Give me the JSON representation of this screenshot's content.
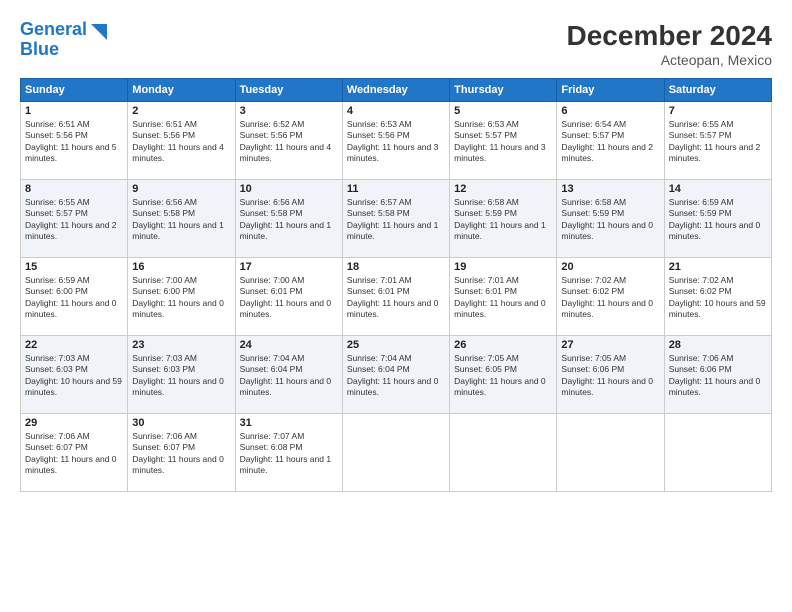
{
  "header": {
    "logo_line1": "General",
    "logo_line2": "Blue",
    "month": "December 2024",
    "location": "Acteopan, Mexico"
  },
  "days_of_week": [
    "Sunday",
    "Monday",
    "Tuesday",
    "Wednesday",
    "Thursday",
    "Friday",
    "Saturday"
  ],
  "weeks": [
    [
      {
        "day": "1",
        "rise": "6:51 AM",
        "set": "5:56 PM",
        "daylight": "11 hours and 5 minutes."
      },
      {
        "day": "2",
        "rise": "6:51 AM",
        "set": "5:56 PM",
        "daylight": "11 hours and 4 minutes."
      },
      {
        "day": "3",
        "rise": "6:52 AM",
        "set": "5:56 PM",
        "daylight": "11 hours and 4 minutes."
      },
      {
        "day": "4",
        "rise": "6:53 AM",
        "set": "5:56 PM",
        "daylight": "11 hours and 3 minutes."
      },
      {
        "day": "5",
        "rise": "6:53 AM",
        "set": "5:57 PM",
        "daylight": "11 hours and 3 minutes."
      },
      {
        "day": "6",
        "rise": "6:54 AM",
        "set": "5:57 PM",
        "daylight": "11 hours and 2 minutes."
      },
      {
        "day": "7",
        "rise": "6:55 AM",
        "set": "5:57 PM",
        "daylight": "11 hours and 2 minutes."
      }
    ],
    [
      {
        "day": "8",
        "rise": "6:55 AM",
        "set": "5:57 PM",
        "daylight": "11 hours and 2 minutes."
      },
      {
        "day": "9",
        "rise": "6:56 AM",
        "set": "5:58 PM",
        "daylight": "11 hours and 1 minute."
      },
      {
        "day": "10",
        "rise": "6:56 AM",
        "set": "5:58 PM",
        "daylight": "11 hours and 1 minute."
      },
      {
        "day": "11",
        "rise": "6:57 AM",
        "set": "5:58 PM",
        "daylight": "11 hours and 1 minute."
      },
      {
        "day": "12",
        "rise": "6:58 AM",
        "set": "5:59 PM",
        "daylight": "11 hours and 1 minute."
      },
      {
        "day": "13",
        "rise": "6:58 AM",
        "set": "5:59 PM",
        "daylight": "11 hours and 0 minutes."
      },
      {
        "day": "14",
        "rise": "6:59 AM",
        "set": "5:59 PM",
        "daylight": "11 hours and 0 minutes."
      }
    ],
    [
      {
        "day": "15",
        "rise": "6:59 AM",
        "set": "6:00 PM",
        "daylight": "11 hours and 0 minutes."
      },
      {
        "day": "16",
        "rise": "7:00 AM",
        "set": "6:00 PM",
        "daylight": "11 hours and 0 minutes."
      },
      {
        "day": "17",
        "rise": "7:00 AM",
        "set": "6:01 PM",
        "daylight": "11 hours and 0 minutes."
      },
      {
        "day": "18",
        "rise": "7:01 AM",
        "set": "6:01 PM",
        "daylight": "11 hours and 0 minutes."
      },
      {
        "day": "19",
        "rise": "7:01 AM",
        "set": "6:01 PM",
        "daylight": "11 hours and 0 minutes."
      },
      {
        "day": "20",
        "rise": "7:02 AM",
        "set": "6:02 PM",
        "daylight": "11 hours and 0 minutes."
      },
      {
        "day": "21",
        "rise": "7:02 AM",
        "set": "6:02 PM",
        "daylight": "10 hours and 59 minutes."
      }
    ],
    [
      {
        "day": "22",
        "rise": "7:03 AM",
        "set": "6:03 PM",
        "daylight": "10 hours and 59 minutes."
      },
      {
        "day": "23",
        "rise": "7:03 AM",
        "set": "6:03 PM",
        "daylight": "11 hours and 0 minutes."
      },
      {
        "day": "24",
        "rise": "7:04 AM",
        "set": "6:04 PM",
        "daylight": "11 hours and 0 minutes."
      },
      {
        "day": "25",
        "rise": "7:04 AM",
        "set": "6:04 PM",
        "daylight": "11 hours and 0 minutes."
      },
      {
        "day": "26",
        "rise": "7:05 AM",
        "set": "6:05 PM",
        "daylight": "11 hours and 0 minutes."
      },
      {
        "day": "27",
        "rise": "7:05 AM",
        "set": "6:06 PM",
        "daylight": "11 hours and 0 minutes."
      },
      {
        "day": "28",
        "rise": "7:06 AM",
        "set": "6:06 PM",
        "daylight": "11 hours and 0 minutes."
      }
    ],
    [
      {
        "day": "29",
        "rise": "7:06 AM",
        "set": "6:07 PM",
        "daylight": "11 hours and 0 minutes."
      },
      {
        "day": "30",
        "rise": "7:06 AM",
        "set": "6:07 PM",
        "daylight": "11 hours and 0 minutes."
      },
      {
        "day": "31",
        "rise": "7:07 AM",
        "set": "6:08 PM",
        "daylight": "11 hours and 1 minute."
      },
      null,
      null,
      null,
      null
    ]
  ]
}
